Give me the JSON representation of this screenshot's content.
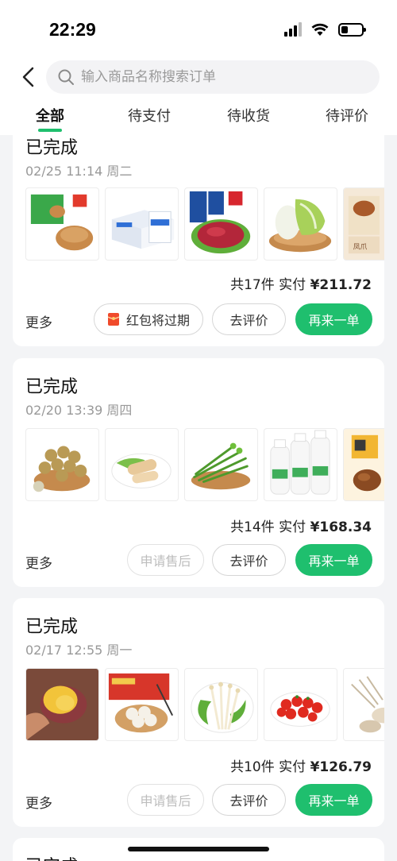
{
  "status_bar": {
    "time": "22:29"
  },
  "search": {
    "placeholder": "输入商品名称搜索订单"
  },
  "tabs": [
    {
      "label": "全部",
      "active": true
    },
    {
      "label": "待支付"
    },
    {
      "label": "待收货"
    },
    {
      "label": "待评价"
    }
  ],
  "orders": [
    {
      "status": "已完成",
      "date": "02/25 11:14 周二",
      "count_text": "共17件",
      "paid_label": "实付",
      "amount": "¥211.72",
      "more_label": "更多",
      "buttons": {
        "left": "红包将过期",
        "review": "去评价",
        "reorder": "再来一单"
      },
      "items": [
        "red-bean-bun",
        "fresh-milk-box",
        "sliced-beef",
        "napa-cabbage",
        "braised-dish"
      ]
    },
    {
      "status": "已完成",
      "date": "02/20 13:39 周四",
      "count_text": "共14件",
      "paid_label": "实付",
      "amount": "¥168.34",
      "more_label": "更多",
      "buttons": {
        "left": "申请售后",
        "review": "去评价",
        "reorder": "再来一单"
      },
      "items": [
        "longan",
        "tofu-rolls",
        "garlic-sprouts",
        "milk-bottles",
        "snack-pack"
      ]
    },
    {
      "status": "已完成",
      "date": "02/17 12:55 周一",
      "count_text": "共10件",
      "paid_label": "实付",
      "amount": "¥126.79",
      "more_label": "更多",
      "buttons": {
        "left": "申请售后",
        "review": "去评价",
        "reorder": "再来一单"
      },
      "items": [
        "sweet-potato",
        "dumplings",
        "enoki-mushroom",
        "cherry-tomatoes",
        "shrimp"
      ]
    },
    {
      "status": "已完成"
    }
  ],
  "colors": {
    "accent": "#1fbf6e",
    "background": "#f3f4f6",
    "card": "#ffffff",
    "muted": "#999999"
  }
}
